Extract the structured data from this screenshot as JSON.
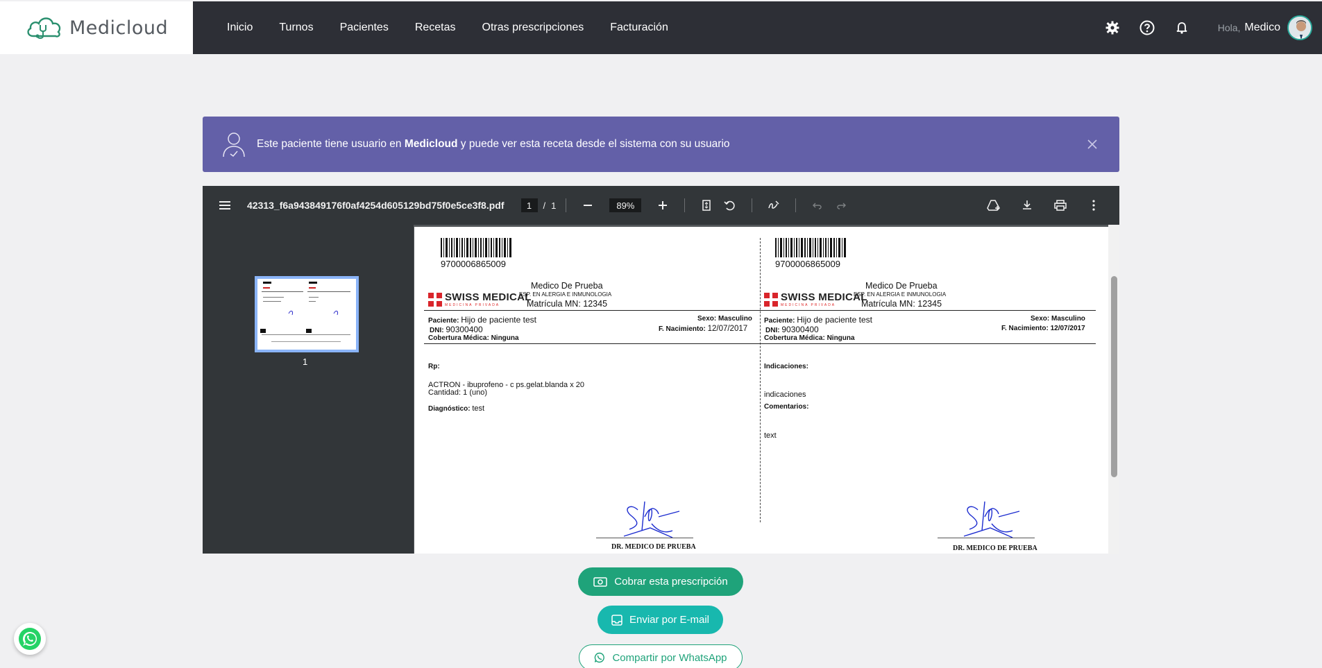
{
  "header": {
    "brand": "Medicloud",
    "nav": [
      "Inicio",
      "Turnos",
      "Pacientes",
      "Recetas",
      "Otras prescripciones",
      "Facturación"
    ],
    "greeting": "Hola,",
    "user_name": "Medico"
  },
  "alert": {
    "text_before": "Este paciente tiene usuario en ",
    "brand": "Medicloud",
    "text_after": " y puede ver esta receta desde el sistema con su usuario"
  },
  "viewer": {
    "filename": "42313_f6a943849176f0af4254d605129bd75f0e5ce3f8.pdf",
    "current_page": "1",
    "page_sep": "/",
    "total_pages": "1",
    "zoom": "89%",
    "thumb_number": "1"
  },
  "prescription": {
    "barcode_number": "9700006865009",
    "insurer_name": "SWISS MEDICAL",
    "insurer_sub": "MEDICINA PRIVADA",
    "doctor_name": "Medico De Prueba",
    "doctor_specialty": "ESP. EN ALERGIA E INMUNOLOGIA",
    "doctor_license": "Matrícula MN: 12345",
    "patient_label": "Paciente:",
    "patient_name": "Hijo de paciente test",
    "dni_label": "DNI:",
    "dni": "90300400",
    "coverage_label": "Cobertura Médica:",
    "coverage": "Ninguna",
    "sex_label": "Sexo:",
    "sex": "Masculino",
    "birth_label": "F. Nacimiento:",
    "birth_date": "12/07/2017",
    "rp_label": "Rp:",
    "drug": "ACTRON - ibuprofeno - c ps.gelat.blanda x 20",
    "quantity": "Cantidad: 1 (uno)",
    "diagnosis_label": "Diagnóstico:",
    "diagnosis": "test",
    "indications_label": "Indicaciones:",
    "indications": "indicaciones",
    "comments_label": "Comentarios:",
    "comments": "text",
    "signature_name": "DR. MEDICO DE PRUEBA"
  },
  "actions": {
    "pay": "Cobrar esta prescripción",
    "email": "Enviar por E-mail",
    "whatsapp": "Compartir por WhatsApp"
  },
  "colors": {
    "header_bg": "#2d2f36",
    "alert_bg": "#6360a8",
    "pay_btn": "#1fa37a",
    "email_btn": "#18b8ae",
    "viewer_toolbar": "#323639"
  }
}
